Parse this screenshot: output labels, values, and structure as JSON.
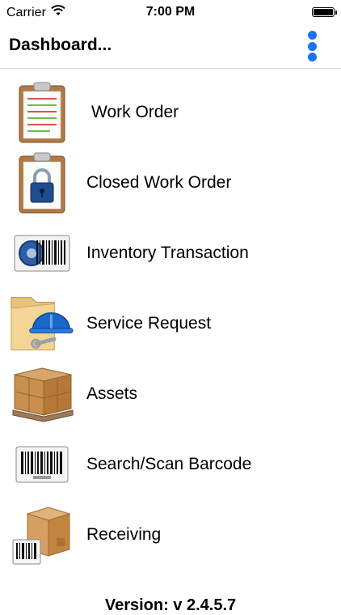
{
  "status_bar": {
    "carrier": "Carrier",
    "time": "7:00 PM",
    "wifi_icon": "wifi-icon",
    "battery_icon": "battery-icon"
  },
  "nav": {
    "title": "Dashboard...",
    "menu_icon": "vertical-ellipsis-icon",
    "accent_color": "#1a73f5"
  },
  "menu": {
    "items": [
      {
        "label": "Work Order",
        "icon": "clipboard-icon"
      },
      {
        "label": "Closed Work Order",
        "icon": "locked-clipboard-icon"
      },
      {
        "label": "Inventory Transaction",
        "icon": "barcode-gear-icon"
      },
      {
        "label": "Service Request",
        "icon": "folder-hardhat-icon"
      },
      {
        "label": "Assets",
        "icon": "boxes-pallet-icon"
      },
      {
        "label": "Search/Scan Barcode",
        "icon": "barcode-icon"
      },
      {
        "label": "Receiving",
        "icon": "box-barcode-icon"
      }
    ]
  },
  "footer": {
    "version": "Version: v 2.4.5.7"
  }
}
